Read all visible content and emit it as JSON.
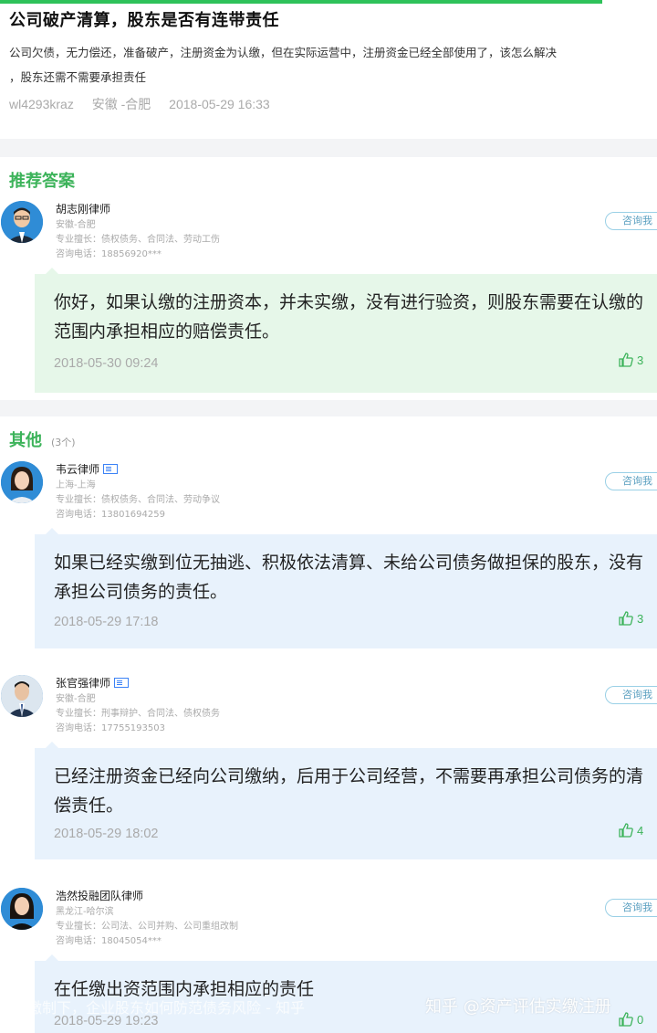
{
  "question": {
    "title": "公司破产清算，股东是否有连带责任",
    "body_line1": "公司欠债，无力偿还，准备破产，注册资金为认缴，但在实际运营中，注册资金已经全部使用了，该怎么解决",
    "body_line2": "，股东还需不需要承担责任",
    "user": "wl4293kraz",
    "location": "安徽 -合肥",
    "time": "2018-05-29 16:33"
  },
  "recommended": {
    "heading": "推荐答案",
    "answer": {
      "name": "胡志刚律师",
      "location": "安徽-合肥",
      "specialty": "专业擅长：债权债务、合同法、劳动工伤",
      "phone": "咨询电话：18856920***",
      "consult_label": "咨询我",
      "text": "你好，如果认缴的注册资本，并未实缴，没有进行验资，则股东需要在认缴的范围内承担相应的赔偿责任。",
      "time": "2018-05-30 09:24",
      "likes": "3"
    }
  },
  "others": {
    "heading": "其他",
    "count": "(3个)",
    "answers": [
      {
        "name": "韦云律师",
        "location": "上海-上海",
        "specialty": "专业擅长：债权债务、合同法、劳动争议",
        "phone": "咨询电话：13801694259",
        "consult_label": "咨询我",
        "text": "如果已经实缴到位无抽逃、积极依法清算、未给公司债务做担保的股东，没有承担公司债务的责任。",
        "time": "2018-05-29 17:18",
        "likes": "3"
      },
      {
        "name": "张官强律师",
        "location": "安徽-合肥",
        "specialty": "专业擅长：刑事辩护、合同法、债权债务",
        "phone": "咨询电话：17755193503",
        "consult_label": "咨询我",
        "text": "已经注册资金已经向公司缴纳，后用于公司经营，不需要再承担公司债务的清偿责任。",
        "time": "2018-05-29 18:02",
        "likes": "4"
      },
      {
        "name": "浩然投融团队律师",
        "location": "黑龙江-哈尔滨",
        "specialty": "专业擅长：公司法、公司并购、公司重组改制",
        "phone": "咨询电话：18045054***",
        "consult_label": "咨询我",
        "text": "在任缴出资范围内承担相应的责任",
        "time": "2018-05-29 19:23",
        "likes": "0"
      }
    ]
  },
  "watermark": {
    "left": "缴制下，企业股东如何防范债务风险 - 知乎",
    "right": "知乎 @资产评估实缴注册"
  },
  "colors": {
    "accent": "#3cb35a",
    "green_bubble": "#e6f7e9",
    "blue_bubble": "#e8f2fc"
  }
}
